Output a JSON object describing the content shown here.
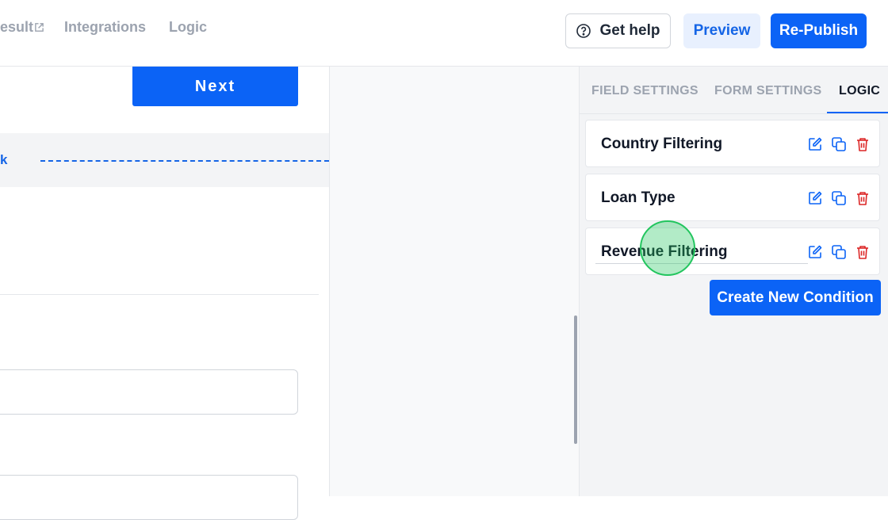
{
  "header": {
    "nav": [
      {
        "label": "esult"
      },
      {
        "label": "Integrations"
      },
      {
        "label": "Logic"
      }
    ],
    "help_label": "Get help",
    "preview_label": "Preview",
    "republish_label": "Re-Publish"
  },
  "canvas": {
    "next_label": "Next",
    "page_break_label": "k"
  },
  "panel": {
    "tabs": [
      {
        "label": "FIELD SETTINGS"
      },
      {
        "label": "FORM SETTINGS"
      },
      {
        "label": "LOGIC"
      }
    ],
    "conditions": [
      {
        "name": "Country Filtering"
      },
      {
        "name": "Loan Type"
      },
      {
        "name": "Revenue Filtering"
      }
    ],
    "create_label": "Create New Condition"
  },
  "colors": {
    "accent": "#0b63f6",
    "delete": "#dc2626",
    "click_marker": "#22c55e"
  }
}
